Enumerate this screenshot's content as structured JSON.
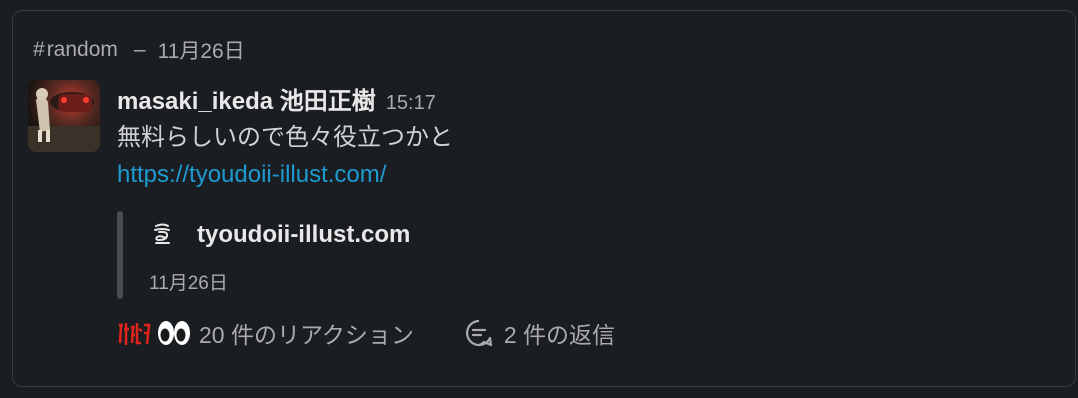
{
  "header": {
    "hash": "#",
    "channel": "random",
    "separator": "–",
    "date": "11月26日"
  },
  "message": {
    "author": "masaki_ikeda 池田正樹",
    "time": "15:17",
    "text": "無料らしいので色々役立つかと",
    "link": "https://tyoudoii-illust.com/"
  },
  "unfurl": {
    "site": "tyoudoii-illust.com",
    "date": "11月26日",
    "icon": "site-favicon-icon"
  },
  "footer": {
    "reaction_summary": "20 件のリアクション",
    "reply_summary": "2 件の返信",
    "reaction_icons": [
      "custom-emoji-icon",
      "eyes-emoji-icon"
    ],
    "reply_icon": "thread-reply-icon"
  },
  "colors": {
    "background": "#1a1d21",
    "border": "#3a3c41",
    "link": "#1d9bd1",
    "muted_text": "#ababad",
    "primary_text": "#e8e8e8"
  }
}
